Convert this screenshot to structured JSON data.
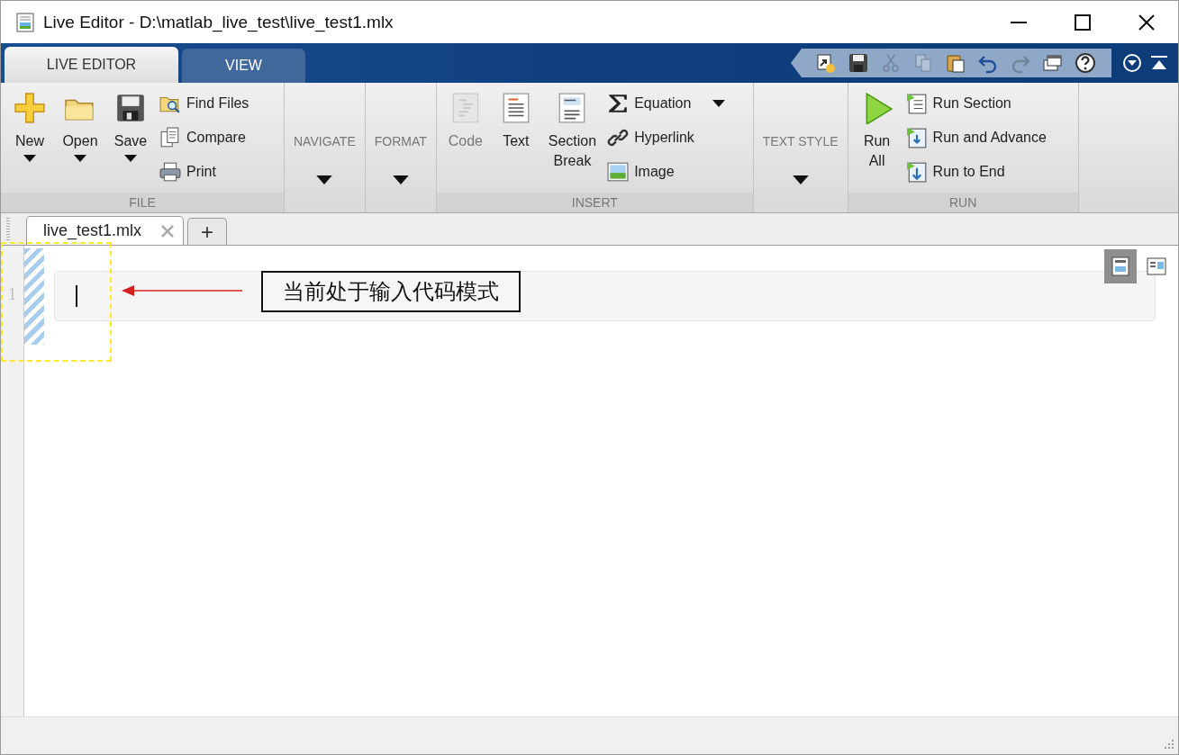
{
  "window": {
    "title": "Live Editor - D:\\matlab_live_test\\live_test1.mlx"
  },
  "tabs": [
    {
      "label": "LIVE EDITOR",
      "selected": true
    },
    {
      "label": "VIEW",
      "selected": false
    }
  ],
  "quick_access": [
    {
      "disabled": false
    },
    {
      "disabled": false
    },
    {
      "disabled": true
    },
    {
      "disabled": true
    },
    {
      "disabled": false
    },
    {
      "disabled": false
    },
    {
      "disabled": true
    },
    {
      "disabled": false
    },
    {
      "disabled": false
    }
  ],
  "ribbon": [
    {
      "label": "FILE",
      "big": [
        {
          "label": "New",
          "dropdown": true,
          "disabled": false
        },
        {
          "label": "Open",
          "dropdown": true,
          "disabled": false
        },
        {
          "label": "Save",
          "dropdown": true,
          "disabled": false
        }
      ],
      "small": [
        {
          "label": "Find Files",
          "dropdown": false
        },
        {
          "label": "Compare",
          "dropdown": false
        },
        {
          "label": "Print",
          "dropdown": false
        }
      ]
    },
    {
      "label": "NAVIGATE",
      "kind": "menu"
    },
    {
      "label": "FORMAT",
      "kind": "menu"
    },
    {
      "label": "INSERT",
      "big": [
        {
          "label": "Code",
          "dropdown": false,
          "disabled": true
        },
        {
          "label": "Text",
          "dropdown": false,
          "disabled": false
        },
        {
          "label": "Section Break",
          "dropdown": false,
          "disabled": false
        }
      ],
      "small": [
        {
          "label": "Equation",
          "dropdown": true
        },
        {
          "label": "Hyperlink",
          "dropdown": false
        },
        {
          "label": "Image",
          "dropdown": false
        }
      ]
    },
    {
      "label": "TEXT STYLE",
      "kind": "menu"
    },
    {
      "label": "RUN",
      "big": [
        {
          "label": "Run All",
          "dropdown": false,
          "disabled": false
        }
      ],
      "small": [
        {
          "label": "Run Section",
          "dropdown": false
        },
        {
          "label": "Run and Advance",
          "dropdown": false
        },
        {
          "label": "Run to End",
          "dropdown": false
        }
      ]
    }
  ],
  "documents": [
    {
      "label": "live_test1.mlx",
      "selected": true
    }
  ],
  "new_tab": "+",
  "editor": {
    "line_number": "1",
    "view_buttons": [
      {
        "selected": true
      },
      {
        "selected": false
      }
    ]
  },
  "annotation": {
    "text": "当前处于输入代码模式"
  }
}
